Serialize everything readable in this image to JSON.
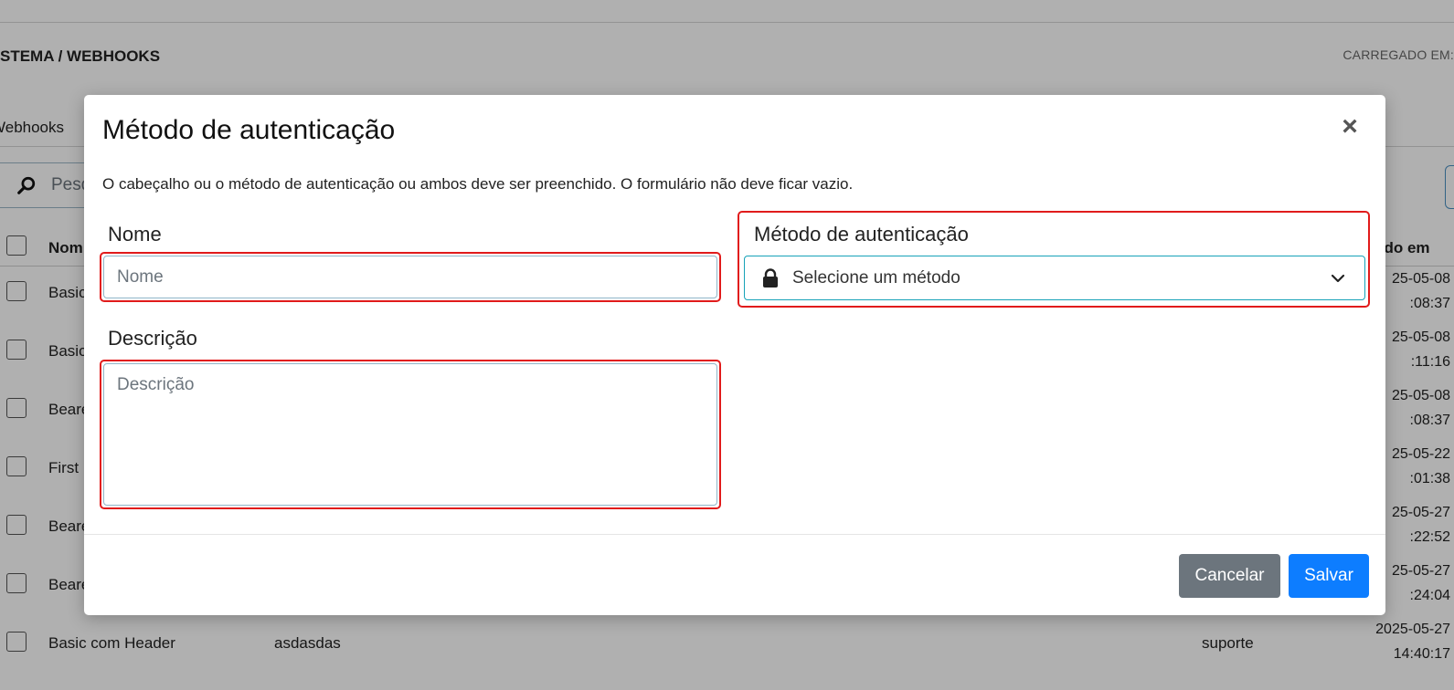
{
  "background": {
    "breadcrumb": "STEMA / WEBHOOKS",
    "loaded_label": "CARREGADO EM:",
    "tab_label": "Webhooks",
    "search_placeholder": "Pesq",
    "table": {
      "header_name": "Nom",
      "header_date": "ado em",
      "rows": [
        {
          "name": "Basic",
          "date_line1": "25-05-08",
          "date_line2": ":08:37"
        },
        {
          "name": "Basic",
          "date_line1": "25-05-08",
          "date_line2": ":11:16"
        },
        {
          "name": "Beare",
          "date_line1": "25-05-08",
          "date_line2": ":08:37"
        },
        {
          "name": "First",
          "date_line1": "25-05-22",
          "date_line2": ":01:38"
        },
        {
          "name": "Beare",
          "date_line1": "25-05-27",
          "date_line2": ":22:52"
        },
        {
          "name": "Beare",
          "date_line1": "25-05-27",
          "date_line2": ":24:04"
        },
        {
          "name": "Basic com Header",
          "description": "asdasdas",
          "user": "suporte",
          "date_line1": "2025-05-27",
          "date_line2": "14:40:17"
        }
      ]
    }
  },
  "modal": {
    "title": "Método de autenticação",
    "close_symbol": "×",
    "info_text": "O cabeçalho ou o método de autenticação ou ambos deve ser preenchido. O formulário não deve ficar vazio.",
    "name_label": "Nome",
    "name_placeholder": "Nome",
    "name_value": "",
    "description_label": "Descrição",
    "description_placeholder": "Descrição",
    "description_value": "",
    "auth_label": "Método de autenticação",
    "auth_select_value": "Selecione um método",
    "auth_icon": "lock-icon",
    "cancel_label": "Cancelar",
    "save_label": "Salvar"
  },
  "colors": {
    "highlight": "#e11b1b",
    "save_button": "#0d7dff",
    "cancel_button": "#6c757d",
    "select_border": "#17a2b8"
  }
}
